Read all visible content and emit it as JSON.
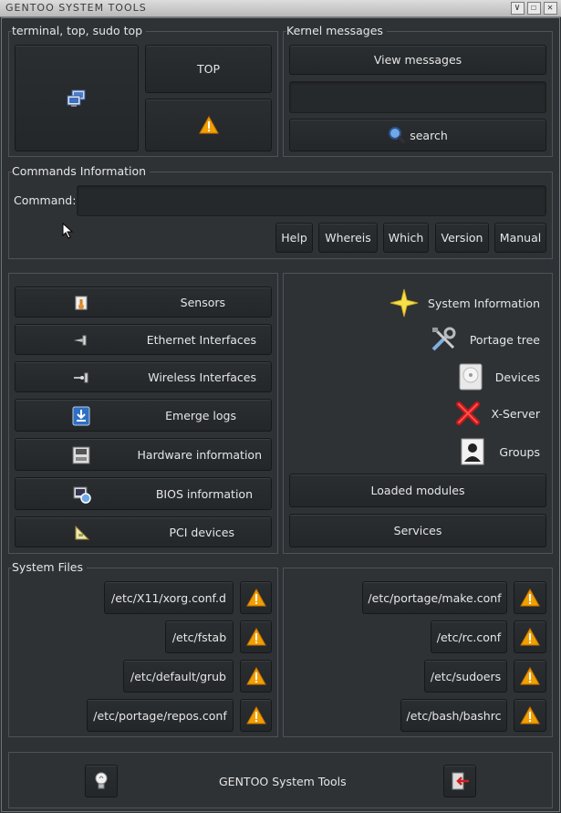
{
  "window": {
    "title": "GENTOO SYSTEM TOOLS",
    "controls": [
      "∨",
      "☐",
      "✕"
    ]
  },
  "terminal_section": {
    "label": "terminal, top, sudo top",
    "top_button": "TOP"
  },
  "kernel_section": {
    "label": "Kernel messages",
    "view_button": "View messages",
    "search_value": "",
    "search_button": "search"
  },
  "commands_section": {
    "label": "Commands Information",
    "command_label": "Command:",
    "command_value": "",
    "buttons": [
      "Help",
      "Whereis",
      "Which",
      "Version",
      "Manual"
    ]
  },
  "hardware_buttons": [
    {
      "label": "Sensors",
      "icon": "sensors-icon"
    },
    {
      "label": "Ethernet Interfaces",
      "icon": "ethernet-icon"
    },
    {
      "label": "Wireless Interfaces",
      "icon": "wireless-icon"
    },
    {
      "label": "Emerge logs",
      "icon": "emerge-logs-icon"
    },
    {
      "label": "Hardware information",
      "icon": "hardware-icon"
    },
    {
      "label": "BIOS information",
      "icon": "bios-icon"
    },
    {
      "label": "PCI devices",
      "icon": "pci-icon"
    }
  ],
  "system_buttons": [
    {
      "label": "System Information",
      "icon": "star-icon"
    },
    {
      "label": "Portage tree",
      "icon": "tools-icon"
    },
    {
      "label": "Devices",
      "icon": "disk-icon"
    },
    {
      "label": "X-Server",
      "icon": "x-server-icon"
    },
    {
      "label": "Groups",
      "icon": "user-icon"
    }
  ],
  "modules_button": "Loaded modules",
  "services_button": "Services",
  "system_files": {
    "label": "System Files",
    "left": [
      "/etc/X11/xorg.conf.d",
      "/etc/fstab",
      "/etc/default/grub",
      "/etc/portage/repos.conf"
    ],
    "right": [
      "/etc/portage/make.conf",
      "/etc/rc.conf",
      "/etc/sudoers",
      "/etc/bash/bashrc"
    ]
  },
  "footer": {
    "title": "GENTOO System Tools"
  },
  "colors": {
    "background": "#2f3235",
    "button": "#25282b",
    "warning": "#f0a000",
    "text": "#e6e6e6"
  }
}
